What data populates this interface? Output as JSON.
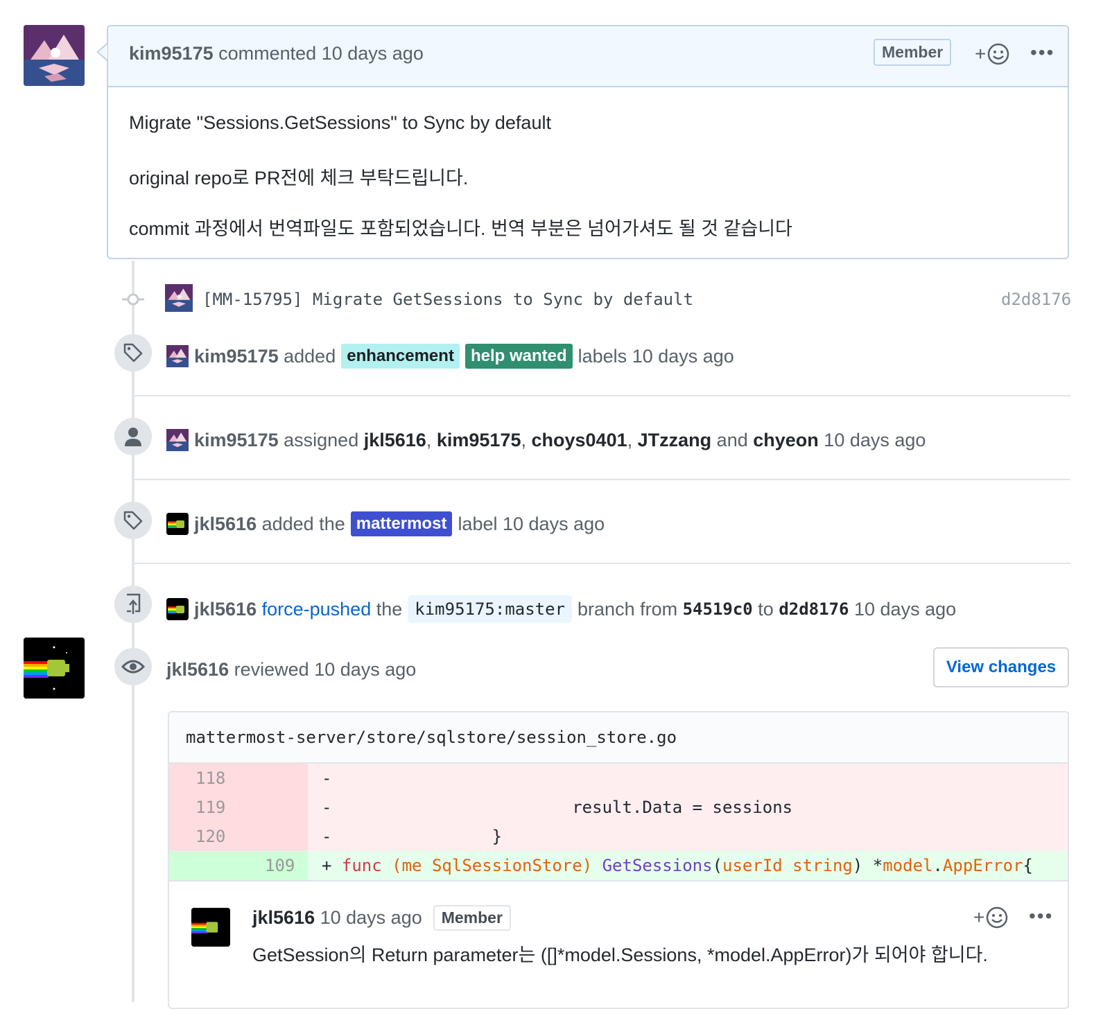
{
  "comment": {
    "author": "kim95175",
    "action": "commented",
    "time": "10 days ago",
    "badge": "Member",
    "reaction_plus": "+",
    "more": "•••",
    "lines": [
      "Migrate \"Sessions.GetSessions\" to Sync by default",
      "original repo로 PR전에 체크 부탁드립니다.",
      "commit 과정에서 번역파일도 포함되었습니다. 번역 부분은 넘어가셔도 될 것 같습니다"
    ]
  },
  "commit": {
    "message": "[MM-15795] Migrate GetSessions to Sync by default",
    "sha": "d2d8176"
  },
  "events": {
    "labels_added": {
      "author": "kim95175",
      "verb": "added",
      "labels": [
        {
          "name": "enhancement",
          "bg": "#b3f0f0",
          "fg": "#1b1f23"
        },
        {
          "name": "help wanted",
          "bg": "#2f8f6f",
          "fg": "#ffffff"
        }
      ],
      "suffix": "labels",
      "time": "10 days ago"
    },
    "assigned": {
      "author": "kim95175",
      "verb": "assigned",
      "a1": "jkl5616",
      "a2": "kim95175",
      "a3": "choys0401",
      "a4": "JTzzang",
      "and": "and",
      "a5": "chyeon",
      "comma": ",",
      "time": "10 days ago"
    },
    "label_added": {
      "author": "jkl5616",
      "verb": "added the",
      "label": {
        "name": "mattermost",
        "bg": "#3e4fd1",
        "fg": "#ffffff"
      },
      "suffix": "label",
      "time": "10 days ago"
    },
    "force_push": {
      "author": "jkl5616",
      "verb": "force-pushed",
      "the": "the",
      "branch": "kim95175:master",
      "from_text": "branch from",
      "from_sha": "54519c0",
      "to_text": "to",
      "to_sha": "d2d8176",
      "time": "10 days ago"
    },
    "review": {
      "author": "jkl5616",
      "verb": "reviewed",
      "time": "10 days ago",
      "button": "View changes"
    }
  },
  "diff": {
    "file": "mattermost-server/store/sqlstore/session_store.go",
    "rows": [
      {
        "num": "118",
        "sign": "-",
        "code": ""
      },
      {
        "num": "119",
        "sign": "-",
        "code": "                        result.Data = sessions"
      },
      {
        "num": "120",
        "sign": "-",
        "code": "                }"
      },
      {
        "num": "109",
        "sign": "+"
      }
    ],
    "added_tokens": {
      "kw": "func",
      "recv_open": "(me",
      "recv_type": "SqlSessionStore)",
      "fn": "GetSessions",
      "param": "userId string",
      "close": ")",
      "star": " *",
      "pkg": "model",
      "dot": ".",
      "ret": "AppError",
      "brace": "{"
    }
  },
  "review_comment": {
    "author": "jkl5616",
    "time": "10 days ago",
    "badge": "Member",
    "reaction_plus": "+",
    "more": "•••",
    "text": "GetSession의 Return parameter는 ([]*model.Sessions, *model.AppError)가 되어야 합니다."
  },
  "colors": {
    "accent_link": "#0366d6",
    "comment_header_bg": "#f1f8ff",
    "diff_del_bg": "#ffeef0",
    "diff_add_bg": "#e6ffed"
  }
}
